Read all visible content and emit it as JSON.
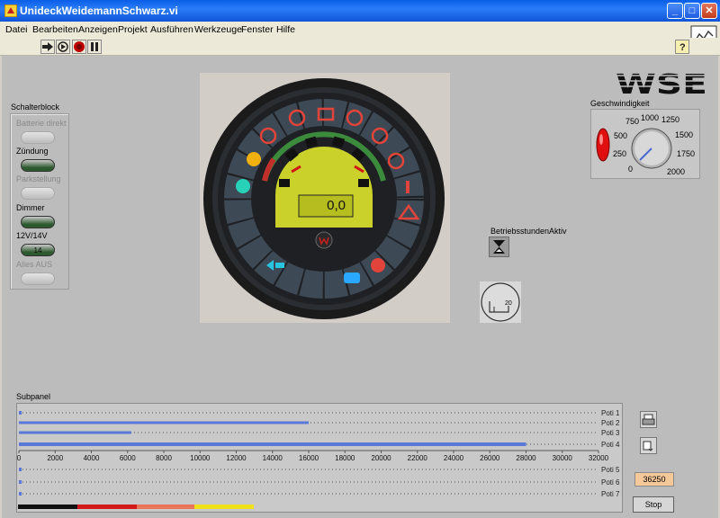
{
  "window": {
    "title": "UnideckWeidemannSchwarz.vi",
    "min_label": "_",
    "max_label": "□",
    "close_label": "✕"
  },
  "menu": [
    "Datei",
    "Bearbeiten",
    "Anzeigen",
    "Projekt",
    "Ausführen",
    "Werkzeuge",
    "Fenster",
    "Hilfe"
  ],
  "toolbar": {
    "icons": [
      "run-arrow-icon",
      "run-continuous-icon",
      "abort-icon",
      "pause-icon"
    ],
    "help_icon": "help-icon"
  },
  "schalterblock": {
    "title": "Schalterblock",
    "switches": [
      {
        "label": "Batterie direkt",
        "state": "disabled",
        "text": ""
      },
      {
        "label": "Zündung",
        "state": "active",
        "text": ""
      },
      {
        "label": "Parkstellung",
        "state": "disabled",
        "text": ""
      },
      {
        "label": "Dimmer",
        "state": "active",
        "text": ""
      },
      {
        "label": "12V/14V",
        "state": "active",
        "text": "14"
      },
      {
        "label": "Alles AUS",
        "state": "disabled",
        "text": ""
      }
    ]
  },
  "dashboard": {
    "display_value": "0,0",
    "brand_mark": "W"
  },
  "logo": {
    "text": "WSE"
  },
  "geschwindigkeit": {
    "title": "Geschwindigkeit",
    "ticks": [
      "0",
      "250",
      "500",
      "750",
      "1000",
      "1250",
      "1500",
      "1750",
      "2000"
    ],
    "value": 0,
    "max": 2000
  },
  "betriebsstunden": {
    "label": "BetriebsstundenAktiv",
    "icon": "hourglass-icon"
  },
  "minigauge": {
    "value_text": "20"
  },
  "subpanel": {
    "title": "Subpanel",
    "axis_ticks": [
      "0",
      "2000",
      "4000",
      "6000",
      "8000",
      "10000",
      "12000",
      "14000",
      "16000",
      "18000",
      "20000",
      "22000",
      "24000",
      "26000",
      "28000",
      "30000",
      "32000"
    ],
    "axis_max": 32000,
    "sliders_top": [
      {
        "label": "Poti 1",
        "value": 0
      },
      {
        "label": "Poti 2",
        "value": 16000
      },
      {
        "label": "Poti 3",
        "value": 6200
      },
      {
        "label": "Poti 4",
        "value": 28000
      }
    ],
    "sliders_bottom": [
      {
        "label": "Poti 5",
        "value": 0
      },
      {
        "label": "Poti 6",
        "value": 0
      },
      {
        "label": "Poti 7",
        "value": 0
      }
    ],
    "status_colors": [
      "#111111",
      "#d21a1a",
      "#e8745a",
      "#f0e21a"
    ]
  },
  "controls": {
    "indicator_value": "36250",
    "stop_label": "Stop",
    "side_icons": [
      "print-icon",
      "print-settings-icon"
    ]
  },
  "colors": {
    "title_bar": "#0a5ee8",
    "panel_bg": "#bcbcbc",
    "slider_fill": "#5a78d8",
    "indicator_bg": "#f5c89a",
    "knob_red": "#e01010"
  }
}
